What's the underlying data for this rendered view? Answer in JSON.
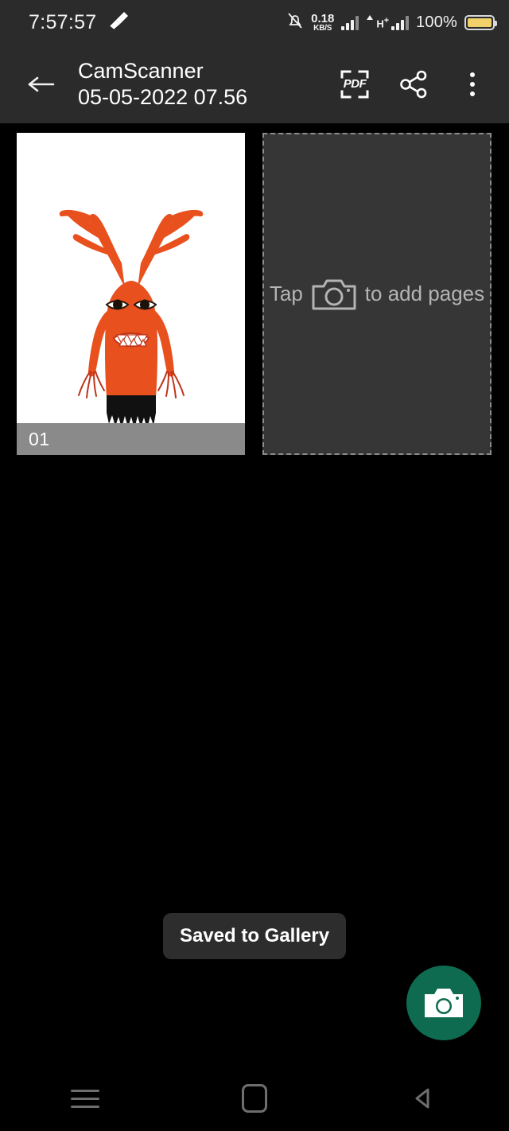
{
  "statusbar": {
    "clock": "7:57:57",
    "broom_icon": "broom-icon",
    "silent_icon": "bell-slash-icon",
    "net_speed_value": "0.18",
    "net_speed_unit": "KB/S",
    "signal_icon": "signal-bars-icon",
    "network_type": "H",
    "network_type_sup": "+",
    "battery_percent": "100%",
    "battery_icon": "battery-full-icon",
    "battery_color": "#f2d16b"
  },
  "appbar": {
    "back_icon": "back-arrow-icon",
    "title_line1": "CamScanner",
    "title_line2": "05-05-2022 07.56",
    "pdf_label": "PDF",
    "pdf_icon": "pdf-export-icon",
    "share_icon": "share-icon",
    "overflow_icon": "overflow-menu-icon",
    "background": "#2b2b2b"
  },
  "pages": {
    "thumbnail": {
      "page_number": "01",
      "alt": "scanned watercolor drawing of orange antlered monster",
      "label_background": "#8a8a8a"
    },
    "add_slot": {
      "text_before": "Tap",
      "text_after": "to add pages",
      "camera_icon": "camera-outline-icon",
      "background": "#363636",
      "border_color": "#8d8d8d"
    }
  },
  "toast": {
    "message": "Saved to Gallery"
  },
  "fab": {
    "icon": "camera-icon",
    "color": "#0f6b4f"
  },
  "navbar": {
    "recents_icon": "menu-icon",
    "home_icon": "home-square-icon",
    "back_icon": "back-triangle-icon"
  }
}
